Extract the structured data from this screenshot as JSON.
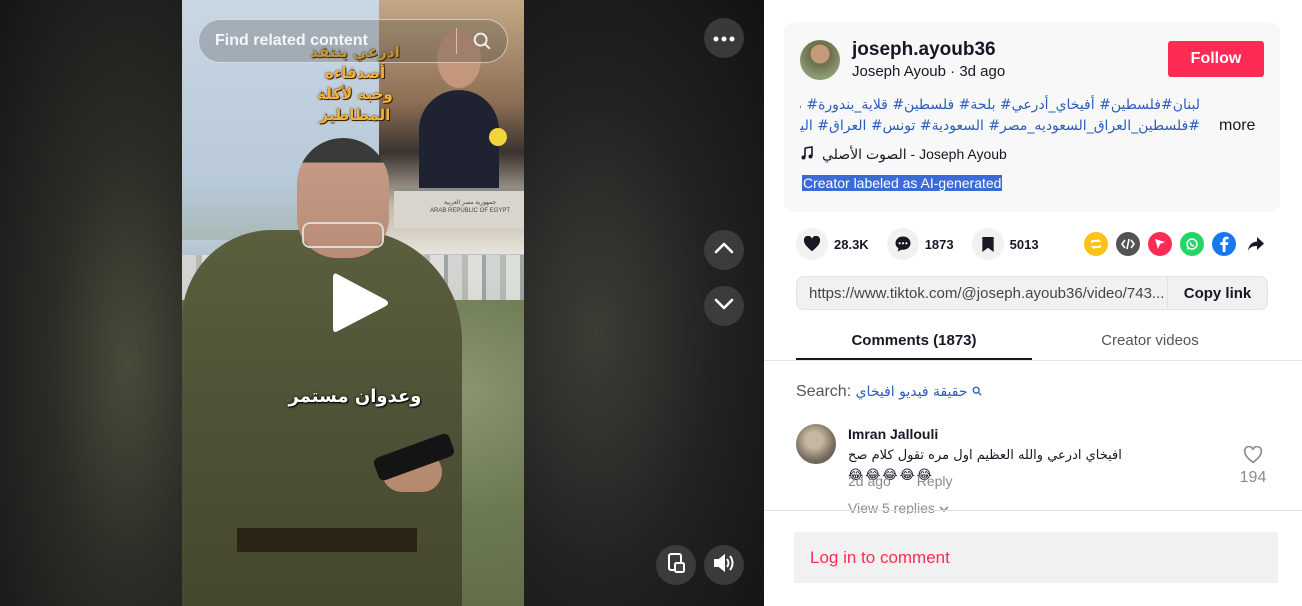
{
  "video": {
    "search_placeholder": "Find related content",
    "overlay_text_line1": "ادرعي ينتقد أصدقاءه",
    "overlay_text_line2": "وحبه لأكلة المطاطيز",
    "subtitle": "وعدوان مستمر",
    "inset_podium_ar": "جمهورية مصر العربية",
    "inset_podium_en": "ARAB REPUBLIC OF EGYPT",
    "icons": [
      "search-icon",
      "more-icon",
      "play-icon",
      "chevron-up-icon",
      "chevron-down-icon",
      "floating-player-icon",
      "volume-icon"
    ]
  },
  "post": {
    "username": "joseph.ayoub36",
    "display_name": "Joseph Ayoub",
    "separator": " · ",
    "time_ago": "3d ago",
    "follow_label": "Follow",
    "description_line1": "لبنان#فلسطين# أفيخاي_أدرعي# بلحة# فلسطين# قلاية_بندورة# مصر#EG",
    "description_line2": "#فلسطين_العراق_السعوديه_مصر# السعودية# تونس# العراق# اليمن...",
    "more_label": "more",
    "music": "الصوت الأصلي - Joseph Ayoub",
    "ai_label": "Creator labeled as AI-generated"
  },
  "stats": {
    "likes": "28.3K",
    "comments": "1873",
    "saves": "5013"
  },
  "share": {
    "url": "https://www.tiktok.com/@joseph.ayoub36/video/743...",
    "copy_label": "Copy link"
  },
  "tabs": {
    "comments_label": "Comments (1873)",
    "creator_videos_label": "Creator videos"
  },
  "search": {
    "label": "Search:",
    "query": "حقيقة فيديو افيخاي"
  },
  "comments": [
    {
      "name": "Imran Jallouli",
      "text": "افيخاي ادرعي والله العظيم اول مره تقول كلام صح",
      "emoji": "😂😂😂😂😂",
      "time": "2d ago",
      "reply_label": "Reply",
      "likes": "194",
      "replies_label": "View 5 replies"
    }
  ],
  "login_label": "Log in to comment",
  "colors": {
    "accent": "#fe2c55",
    "link_blue": "#2b5db9",
    "ai_label_bg": "#3a6bd6"
  }
}
